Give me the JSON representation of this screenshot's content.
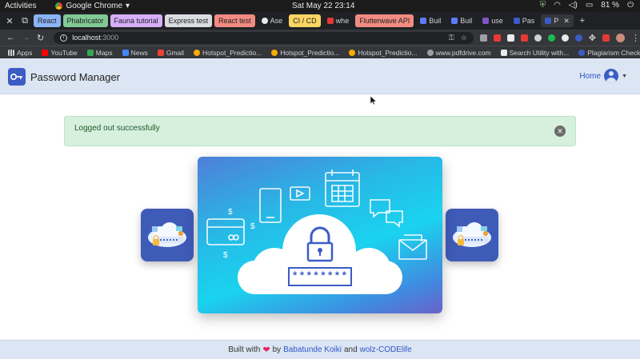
{
  "system": {
    "activities": "Activities",
    "app_name": "Google Chrome",
    "clock": "Sat May 22  23:14",
    "battery": "81 %"
  },
  "tabs": [
    {
      "label": "React",
      "color": "#8ab4f8"
    },
    {
      "label": "Phabricator",
      "color": "#81c995"
    },
    {
      "label": "Fauna tutorial",
      "color": "#d7aefb"
    },
    {
      "label": "Express test",
      "color": "#dadce0"
    },
    {
      "label": "React test",
      "color": "#f28b82"
    },
    {
      "label": "Ase",
      "color": ""
    },
    {
      "label": "CI / CD",
      "color": "#fdd663"
    },
    {
      "label": "whe",
      "color": ""
    },
    {
      "label": "Flutterwave API",
      "color": "#f28b82"
    },
    {
      "label": "Buil",
      "color": ""
    },
    {
      "label": "Buil",
      "color": ""
    },
    {
      "label": "use",
      "color": ""
    },
    {
      "label": "Pas",
      "color": ""
    },
    {
      "label": "P",
      "color": ""
    }
  ],
  "address_bar": {
    "host": "localhost",
    "port": ":3000"
  },
  "bookmarks": [
    "Apps",
    "YouTube",
    "Maps",
    "News",
    "Gmail",
    "Hotspot_Predictio...",
    "Hotspot_Predictio...",
    "Hotspot_Predictio...",
    "www.pdfdrive.com",
    "Search Utility with...",
    "Plagiarism Checke..."
  ],
  "navbar": {
    "brand": "Password Manager",
    "home": "Home"
  },
  "alert": {
    "message": "Logged out successfully",
    "close_symbol": "✕"
  },
  "hero": {
    "password_mask": "********"
  },
  "footer": {
    "prefix": "Built with",
    "by": "by",
    "author": "Babatunde Koiki",
    "and": "and",
    "coauthor": "wolz-CODElife"
  },
  "colors": {
    "brand_blue": "#3b5cc4",
    "navbar_bg": "#dce5f3",
    "alert_bg": "#d6f0dd",
    "link": "#2d57c8"
  }
}
